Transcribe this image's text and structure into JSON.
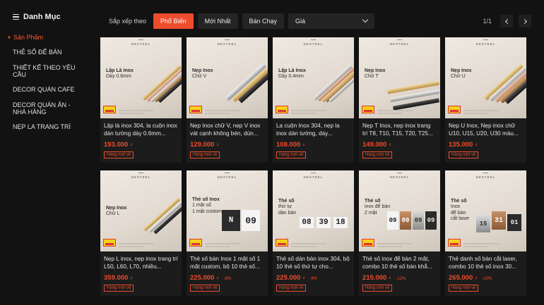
{
  "sidebar": {
    "title": "Danh Mục",
    "items": [
      {
        "label": "Sản Phẩm",
        "active": true
      },
      {
        "label": "THẺ SỐ ĐỂ BÀN",
        "active": false
      },
      {
        "label": "THIẾT KẾ THEO YÊU CẦU",
        "active": false
      },
      {
        "label": "DECOR QUÁN CAFE",
        "active": false
      },
      {
        "label": "DECOR QUÁN ĂN - NHÀ HÀNG",
        "active": false
      },
      {
        "label": "NẸP LA TRANG TRÍ",
        "active": false
      }
    ]
  },
  "sortbar": {
    "label": "Sắp xếp theo",
    "options": [
      "Phổ Biến",
      "Mới Nhất",
      "Bán Chạy"
    ],
    "active_index": 0,
    "price_select": "Giá",
    "page": "1/1"
  },
  "currency_symbol": "₫",
  "products": [
    {
      "thumb_title": "Lập Là Inox",
      "thumb_sub": "Dày 0.6mm",
      "name": "Lập là inox 304, la cuộn inox dán tường dày 0.6mm...",
      "price": "193.000",
      "discount": "",
      "tag": "Hàng mới về"
    },
    {
      "thumb_title": "Nẹp Inox",
      "thumb_sub": "Chữ V",
      "name": "Nẹp Inox chữ V, nẹp V inox vát cạnh không bén, dùn...",
      "price": "129.000",
      "discount": "",
      "tag": "Hàng mới về"
    },
    {
      "thumb_title": "Lập Là Inox",
      "thumb_sub": "Dày 0.4mm",
      "name": "La cuộn Inox 304, nẹp la inox dán tường, dày...",
      "price": "108.000",
      "discount": "",
      "tag": "Hàng mới về"
    },
    {
      "thumb_title": "Nẹp Inox",
      "thumb_sub": "Chữ T",
      "name": "Nẹp T Inox, nẹp inox trang trí T8, T10, T15, T20, T25...",
      "price": "149.000",
      "discount": "",
      "tag": "Hàng mới về"
    },
    {
      "thumb_title": "Nẹp Inox",
      "thumb_sub": "Chữ U",
      "name": "Nẹp U Inox, Nẹp inox chữ U10, U15, U20, U30 màu...",
      "price": "135.000",
      "discount": "",
      "tag": "Hàng mới về"
    },
    {
      "thumb_title": "Nẹp Inox",
      "thumb_sub": "Chữ L",
      "name": "Nẹp L inox, nẹp inox trang trí L50, L60, L70, nhiều...",
      "price": "359.000",
      "discount": "",
      "tag": "Hàng mới về"
    },
    {
      "thumb_title": "Thẻ số Inox",
      "thumb_sub": "1 mặt số\n1 mặt custom",
      "name": "Thẻ số bàn Inox 1 mặt số 1 mặt custom, bộ 10 thẻ số...",
      "price": "225.000",
      "discount": "-8%",
      "tag": "Hàng mới về",
      "plates": [
        "N",
        "09"
      ]
    },
    {
      "thumb_title": "Thẻ số",
      "thumb_sub": "thứ tự\ndán bàn",
      "name": "Thẻ số dán bàn inox 304, bộ 10 thẻ số thứ tự cho...",
      "price": "225.000",
      "discount": "-8%",
      "tag": "Hàng mới về",
      "plates": [
        "08",
        "39",
        "18"
      ]
    },
    {
      "thumb_title": "Thẻ số",
      "thumb_sub": "inox để bàn\n2 mặt",
      "name": "Thẻ số inox để bàn 2 mặt, combo 10 thẻ số bàn khắ...",
      "price": "215.000",
      "discount": "-12%",
      "tag": "Hàng mới về",
      "plates": [
        "09",
        "09",
        "09",
        "09"
      ]
    },
    {
      "thumb_title": "Thẻ số",
      "thumb_sub": "Inox\nđể bàn\ncắt laser",
      "name": "Thẻ danh số bàn cắt laser, combo 10 thẻ số inox 30...",
      "price": "265.000",
      "discount": "-10%",
      "tag": "Hàng mới về",
      "plates": [
        "15",
        "31",
        "01"
      ]
    }
  ],
  "colors": {
    "accent": "#ee4d2d",
    "background": "#121212",
    "card": "#1c1c1c"
  },
  "brand": "NESTEEL"
}
